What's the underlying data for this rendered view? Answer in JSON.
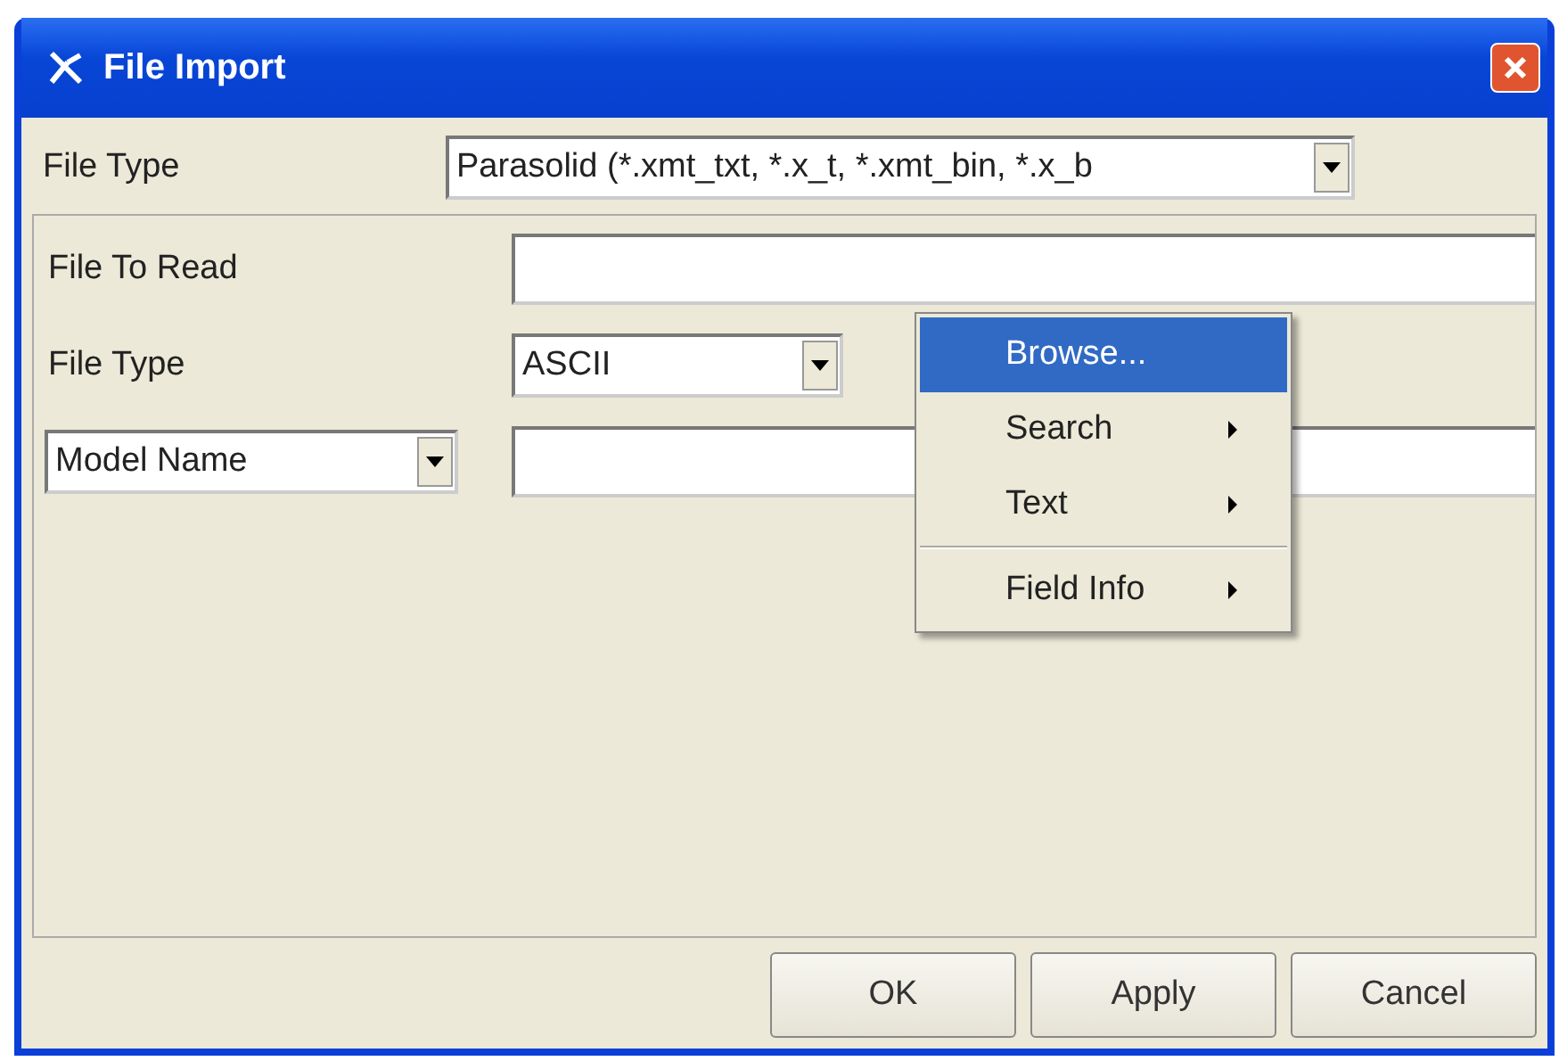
{
  "window": {
    "title": "File Import"
  },
  "file_type": {
    "label": "File Type",
    "value": "Parasolid (*.xmt_txt, *.x_t, *.xmt_bin, *.x_b"
  },
  "panel": {
    "file_to_read": {
      "label": "File To Read"
    },
    "format": {
      "label": "File Type",
      "value": "ASCII"
    },
    "model": {
      "selector": "Model Name"
    }
  },
  "context_menu": [
    {
      "label": "Browse...",
      "selected": true,
      "submenu": false
    },
    {
      "label": "Search",
      "selected": false,
      "submenu": true
    },
    {
      "label": "Text",
      "selected": false,
      "submenu": true
    },
    {
      "label": "Field Info",
      "selected": false,
      "submenu": true,
      "separator_before": true
    }
  ],
  "buttons": [
    "OK",
    "Apply",
    "Cancel"
  ]
}
